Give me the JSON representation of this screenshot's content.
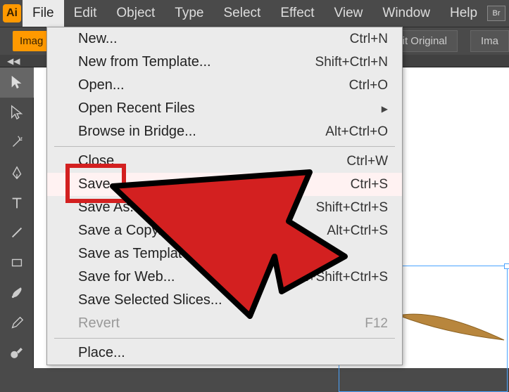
{
  "app_logo_text": "Ai",
  "menubar": {
    "items": [
      "File",
      "Edit",
      "Object",
      "Type",
      "Select",
      "Effect",
      "View",
      "Window",
      "Help"
    ],
    "br_label": "Br"
  },
  "toolbar": {
    "tab_label": "Imag",
    "edit_original": "dit Original",
    "ima_btn": "Ima"
  },
  "collapse_icon": "◀◀",
  "dropdown": {
    "items": [
      {
        "label": "New...",
        "shortcut": "Ctrl+N"
      },
      {
        "label": "New from Template...",
        "shortcut": "Shift+Ctrl+N"
      },
      {
        "label": "Open...",
        "shortcut": "Ctrl+O"
      },
      {
        "label": "Open Recent Files",
        "submenu": true
      },
      {
        "label": "Browse in Bridge...",
        "shortcut": "Alt+Ctrl+O"
      },
      {
        "sep": true
      },
      {
        "label": "Close",
        "shortcut": "Ctrl+W"
      },
      {
        "label": "Save",
        "shortcut": "Ctrl+S",
        "highlighted": true
      },
      {
        "label": "Save As...",
        "shortcut": "Shift+Ctrl+S"
      },
      {
        "label": "Save a Copy...",
        "shortcut": "Alt+Ctrl+S"
      },
      {
        "label": "Save as Template..."
      },
      {
        "label": "Save for Web...",
        "shortcut": "Alt+Shift+Ctrl+S"
      },
      {
        "label": "Save Selected Slices..."
      },
      {
        "label": "Revert",
        "shortcut": "F12",
        "disabled": true
      },
      {
        "sep": true
      },
      {
        "label": "Place..."
      }
    ]
  }
}
